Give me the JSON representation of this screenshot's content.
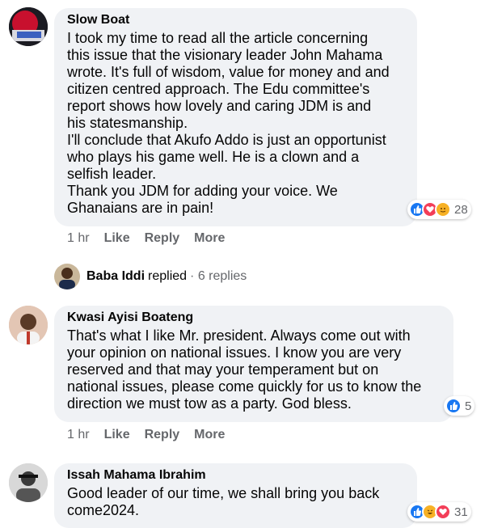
{
  "comments": [
    {
      "author": "Slow Boat",
      "text": "I took my time to read all the article concerning\nthis issue that the visionary leader John Mahama\nwrote. It's full of wisdom, value for money and and\ncitizen centred approach. The Edu committee's\nreport shows how lovely and caring JDM is and\nhis statesmanship.\nI'll conclude that Akufo Addo is just an opportunist\nwho plays his game well. He is a clown and a\nselfish leader.\nThank you JDM for adding your voice. We\nGhanaians are in pain!",
      "reaction_count": "28",
      "time": "1 hr",
      "like": "Like",
      "reply": "Reply",
      "more": "More"
    },
    {
      "author": "Kwasi Ayisi Boateng",
      "text": "That's what I like Mr. president. Always come out with\nyour opinion on national issues. I know you are very\nreserved and that may your temperament but on\nnational issues, please come quickly for us to know the\ndirection we must tow as a party. God bless.",
      "reaction_count": "5",
      "time": "1 hr",
      "like": "Like",
      "reply": "Reply",
      "more": "More"
    },
    {
      "author": "Issah Mahama Ibrahim",
      "text": "Good leader of our time, we shall bring you back\ncome2024.",
      "reaction_count": "31"
    }
  ],
  "replies": {
    "name": "Baba Iddi",
    "action": "replied",
    "count": "· 6 replies"
  },
  "colors": {
    "like_blue": "#1877f2",
    "love_red": "#f33e58",
    "haha_yellow": "#f7b125",
    "bubble_bg": "#f0f2f5",
    "meta_gray": "#65676b"
  }
}
